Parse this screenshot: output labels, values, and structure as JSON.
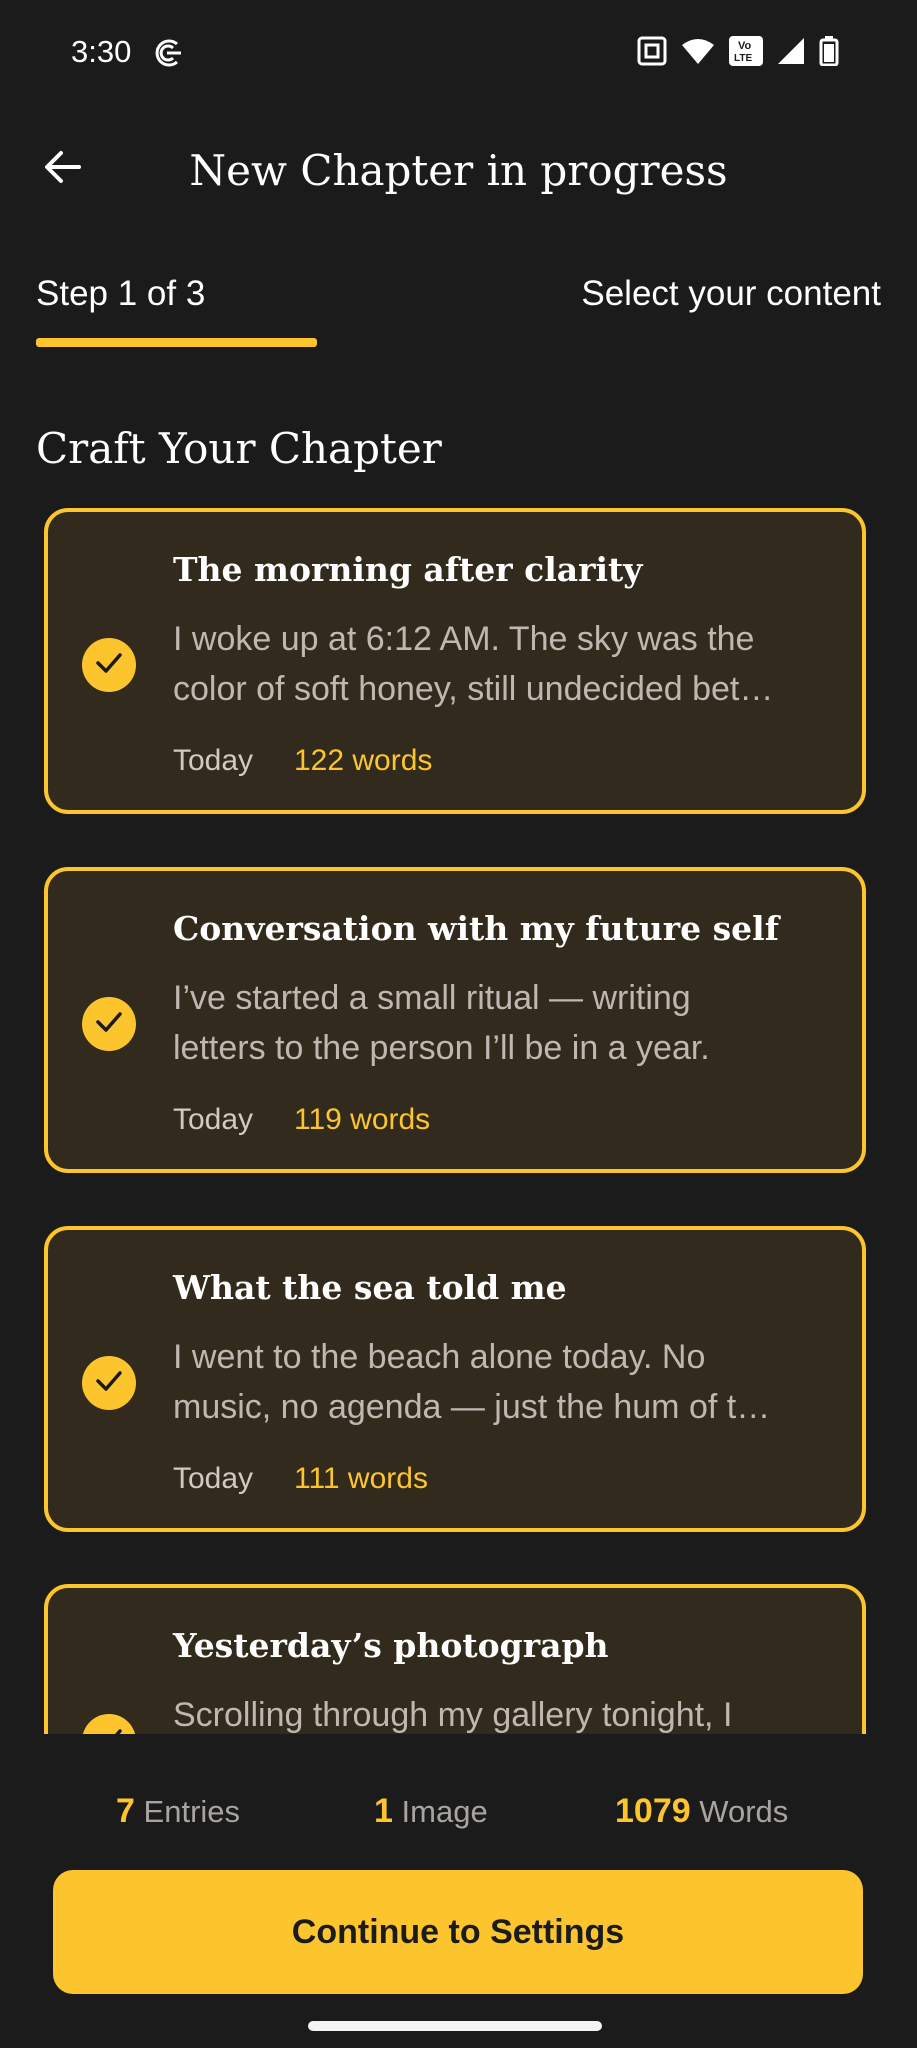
{
  "status_bar": {
    "time": "3:30",
    "icons": [
      "sync-icon",
      "nfc-icon",
      "wifi-icon",
      "volte-icon",
      "cell-signal-icon",
      "battery-icon"
    ],
    "volte_label_top": "Vo",
    "volte_label_bottom": "LTE"
  },
  "app_bar": {
    "back_icon": "arrow-left-icon",
    "title": "New Chapter in progress"
  },
  "stepper": {
    "step_label": "Step 1 of 3",
    "caption": "Select your content",
    "progress_fraction": 0.333
  },
  "section_title": "Craft Your Chapter",
  "entries": [
    {
      "title": "The morning after clarity",
      "excerpt": "I woke up at 6:12 AM. The sky was the\ncolor of soft honey, still undecided bet…",
      "date": "Today",
      "words": "122 words",
      "selected": true
    },
    {
      "title": "Conversation with my future self",
      "excerpt": "I’ve started a small ritual — writing\nletters to the person I’ll be in a year.",
      "date": "Today",
      "words": "119 words",
      "selected": true
    },
    {
      "title": "What the sea told me",
      "excerpt": "I went to the beach alone today. No\nmusic, no agenda — just the hum of t…",
      "date": "Today",
      "words": "111 words",
      "selected": true
    },
    {
      "title": "Yesterday’s photograph",
      "excerpt": "Scrolling through my gallery tonight, I",
      "date": "",
      "words": "",
      "selected": true
    }
  ],
  "stats": {
    "entries_value": "7",
    "entries_label": "Entries",
    "images_value": "1",
    "images_label": "Image",
    "words_value": "1079",
    "words_label": "Words"
  },
  "continue_label": "Continue to Settings",
  "colors": {
    "background": "#1b1b1c",
    "accent": "#fcc52d",
    "card_fill": "#322b1d",
    "muted_text": "#bdb9b2"
  }
}
